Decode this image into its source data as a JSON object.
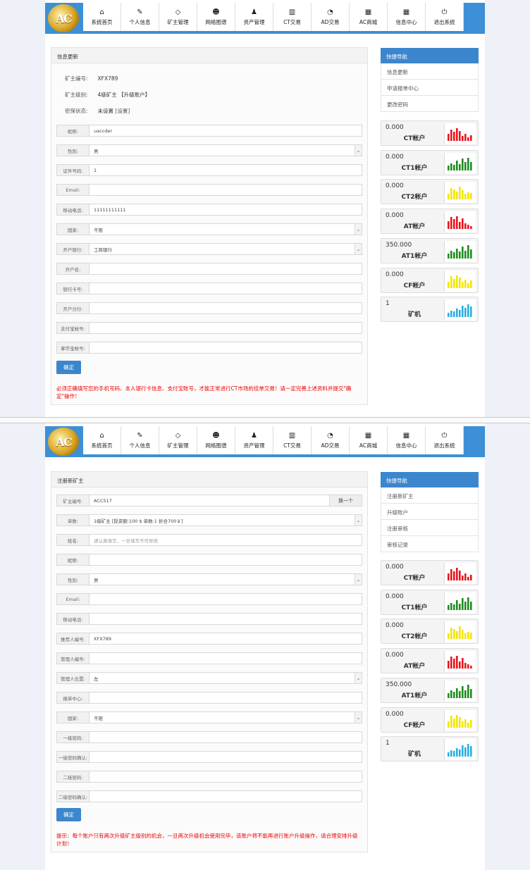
{
  "nav": {
    "logo_text": "AC",
    "items": [
      {
        "label": "系统首页",
        "icon": "home-icon"
      },
      {
        "label": "个人信息",
        "icon": "edit-icon"
      },
      {
        "label": "矿主管理",
        "icon": "diamond-icon"
      },
      {
        "label": "网络图谱",
        "icon": "users-icon"
      },
      {
        "label": "资产管理",
        "icon": "user-icon"
      },
      {
        "label": "CT交易",
        "icon": "bar-chart-icon"
      },
      {
        "label": "AD交易",
        "icon": "dashboard-icon"
      },
      {
        "label": "AC商城",
        "icon": "calendar-icon"
      },
      {
        "label": "信息中心",
        "icon": "calendar-icon"
      },
      {
        "label": "退出系统",
        "icon": "power-icon"
      }
    ]
  },
  "screen1": {
    "panel_title": "信息更新",
    "info": [
      {
        "label": "矿主编号:",
        "value": "XFX789"
      },
      {
        "label": "矿主级别:",
        "value": "4级矿主 【升级账户】"
      },
      {
        "label": "密保状态:",
        "value": "未设置",
        "extra": "[设置]"
      }
    ],
    "fields": [
      {
        "label": "昵称:",
        "value": "uaccder"
      },
      {
        "label": "性别:",
        "value": "男",
        "select": true
      },
      {
        "label": "证件号码:",
        "value": "1"
      },
      {
        "label": "Email:",
        "value": ""
      },
      {
        "label": "移动电话:",
        "value": "11111111111"
      },
      {
        "label": "国家:",
        "value": "不限",
        "select": true
      },
      {
        "label": "开户银行:",
        "value": "工商银行",
        "select": true
      },
      {
        "label": "开户名:",
        "value": ""
      },
      {
        "label": "银行卡号:",
        "value": ""
      },
      {
        "label": "开户分行:",
        "value": ""
      },
      {
        "label": "支付宝帐号:",
        "value": ""
      },
      {
        "label": "掌币宝帐号:",
        "value": ""
      }
    ],
    "ok_label": "确定",
    "note": "必须正确填写您的手机号码、本人银行卡信息、支付宝账号，才能正常进行CT市场的挂单交易！请一定完善上述资料并提交\"确定\"操作！"
  },
  "screen2": {
    "panel_title": "注册新矿主",
    "fields": [
      {
        "label": "矿主编号:",
        "value": "ACC517",
        "button": "换一个"
      },
      {
        "label": "单数:",
        "value": "1级矿主 [投资额:100 $  单数:1 折合700￥]",
        "select": true
      },
      {
        "label": "姓名:",
        "value": "",
        "placeholder": "请认真填写，一旦填写不可修改"
      },
      {
        "label": "昵称:",
        "value": ""
      },
      {
        "label": "性别:",
        "value": "男",
        "select": true
      },
      {
        "label": "Email:",
        "value": ""
      },
      {
        "label": "移动电话:",
        "value": ""
      },
      {
        "label": "推荐人编号:",
        "value": "XFX789"
      },
      {
        "label": "管理人编号:",
        "value": ""
      },
      {
        "label": "管理人位置:",
        "value": "左",
        "select": true
      },
      {
        "label": "报单中心:",
        "value": ""
      },
      {
        "label": "国家:",
        "value": "不限",
        "select": true
      },
      {
        "label": "一级密码:",
        "value": ""
      },
      {
        "label": "一级密码确认:",
        "value": ""
      },
      {
        "label": "二级密码:",
        "value": ""
      },
      {
        "label": "二级密码确认:",
        "value": ""
      }
    ],
    "ok_label": "确定",
    "note": "提示：每个账户只有两次升级矿主级别的机会，一旦两次升级机会使用完毕，该账户将不能再进行账户升级操作，请合理安排升级计划！"
  },
  "side1": {
    "title": "快捷导航",
    "items": [
      "信息更新",
      "申请报单中心",
      "更改密码"
    ]
  },
  "side2": {
    "title": "快捷导航",
    "items": [
      "注册新矿主",
      "升级账户",
      "注册审核",
      "审核记录"
    ]
  },
  "accounts": [
    {
      "value": "0.000",
      "name": "CT帐户",
      "color": "#e8141c"
    },
    {
      "value": "0.000",
      "name": "CT1帐户",
      "color": "#1e8c1e"
    },
    {
      "value": "0.000",
      "name": "CT2帐户",
      "color": "#f2e600"
    },
    {
      "value": "0.000",
      "name": "AT帐户",
      "color": "#e8141c"
    },
    {
      "value": "350.000",
      "name": "AT1帐户",
      "color": "#1e8c1e"
    },
    {
      "value": "0.000",
      "name": "CF帐户",
      "color": "#f2e600"
    },
    {
      "value": "1",
      "name": "矿机",
      "color": "#2aaee0"
    }
  ]
}
